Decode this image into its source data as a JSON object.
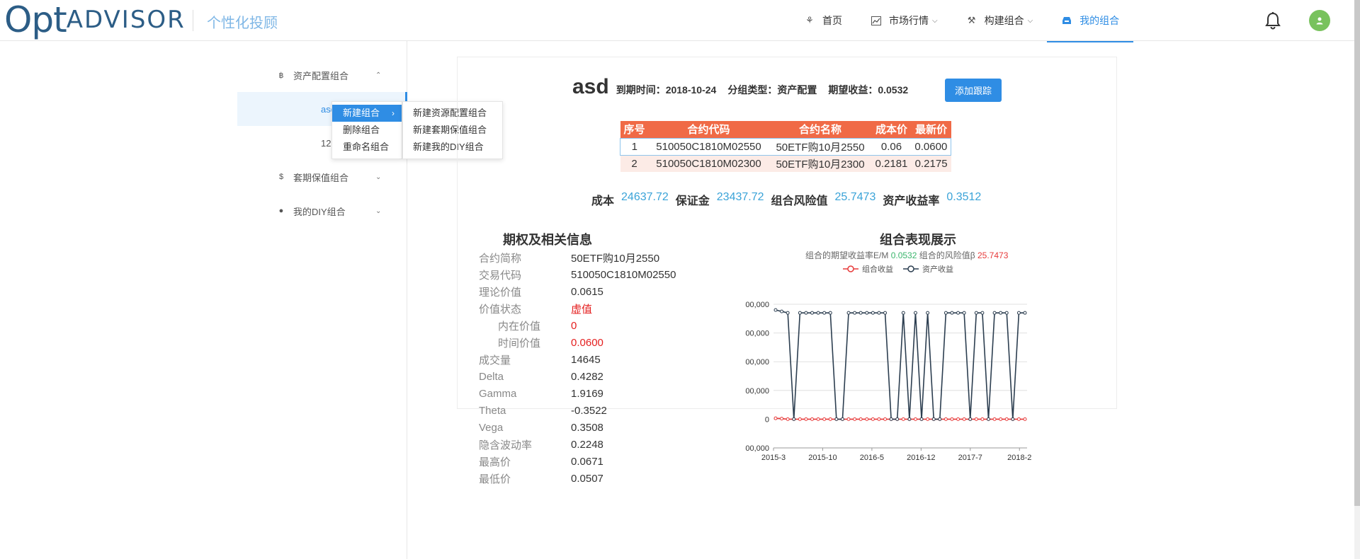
{
  "header": {
    "logo_opt": "Opt",
    "logo_advisor": "ADVISOR",
    "slogan": "个性化投顾",
    "nav": [
      {
        "label": "首页",
        "icon": "rocket-icon"
      },
      {
        "label": "市场行情",
        "icon": "chart-icon"
      },
      {
        "label": "构建组合",
        "icon": "tools-icon"
      },
      {
        "label": "我的组合",
        "icon": "inbox-icon"
      }
    ]
  },
  "sidebar": {
    "groups": [
      {
        "label": "资产配置组合",
        "icon": "bitcoin-icon",
        "caret": "^"
      },
      {
        "label": "套期保值组合",
        "icon": "dollar-icon",
        "caret": "v"
      },
      {
        "label": "我的DIY组合",
        "icon": "bulb-icon",
        "caret": "v"
      }
    ],
    "sub_items": [
      "asd",
      "12"
    ]
  },
  "context_menu": {
    "items": [
      "新建组合",
      "删除组合",
      "重命名组合"
    ],
    "submenu": [
      "新建资源配置组合",
      "新建套期保值组合",
      "新建我的DIY组合"
    ]
  },
  "portfolio": {
    "name": "asd",
    "expiry": "到期时间：2018-10-24",
    "group_type": "分组类型：资产配置",
    "expected": "期望收益：0.0532",
    "track_button": "添加跟踪"
  },
  "holdings": {
    "headers": [
      "序号",
      "合约代码",
      "合约名称",
      "成本价",
      "最新价"
    ],
    "rows": [
      [
        "1",
        "510050C1810M02550",
        "50ETF购10月2550",
        "0.06",
        "0.0600"
      ],
      [
        "2",
        "510050C1810M02300",
        "50ETF购10月2300",
        "0.2181",
        "0.2175"
      ]
    ]
  },
  "summary": [
    {
      "k": "成本",
      "v": "24637.72"
    },
    {
      "k": "保证金",
      "v": "23437.72"
    },
    {
      "k": "组合风险值",
      "v": "25.7473"
    },
    {
      "k": "资产收益率",
      "v": "0.3512"
    }
  ],
  "info": {
    "title": "期权及相关信息",
    "rows": [
      {
        "k": "合约简称",
        "v": "50ETF购10月2550"
      },
      {
        "k": "交易代码",
        "v": "510050C1810M02550"
      },
      {
        "k": "理论价值",
        "v": "0.0615"
      },
      {
        "k": "价值状态",
        "v": "虚值",
        "red": true
      },
      {
        "k": "内在价值",
        "v": "0",
        "red": true,
        "indent": true
      },
      {
        "k": "时间价值",
        "v": "0.0600",
        "red": true,
        "indent": true
      },
      {
        "k": "成交量",
        "v": "14645"
      },
      {
        "k": "Delta",
        "v": "0.4282"
      },
      {
        "k": "Gamma",
        "v": "1.9169"
      },
      {
        "k": "Theta",
        "v": "-0.3522"
      },
      {
        "k": "Vega",
        "v": "0.3508"
      },
      {
        "k": "隐含波动率",
        "v": "0.2248"
      },
      {
        "k": "最高价",
        "v": "0.0671"
      },
      {
        "k": "最低价",
        "v": "0.0507"
      }
    ]
  },
  "chart_panel": {
    "title": "组合表现展示",
    "sub_prefix": "组合的期望收益率E/M",
    "sub_em": "0.0532",
    "sub_mid": "组合的风险值β",
    "sub_beta": "25.7473"
  },
  "chart_data": {
    "type": "line",
    "yticks": [
      "00,000",
      "00,000",
      "00,000",
      "00,000",
      "0",
      "00,000"
    ],
    "xticks": [
      "2015-3",
      "2015-10",
      "2016-5",
      "2016-12",
      "2017-7",
      "2018-2"
    ],
    "ylim": [
      -1,
      4
    ],
    "series": [
      {
        "name": "组合收益",
        "color": "#e73a3a",
        "values": [
          0.03,
          0.02,
          0,
          0,
          0,
          0,
          0,
          0,
          0,
          0,
          0,
          0,
          0,
          0,
          0,
          0,
          0,
          0,
          0,
          0,
          0,
          0,
          0,
          0,
          0,
          0,
          0,
          0,
          0,
          0,
          0,
          0,
          0,
          0,
          0,
          0,
          0,
          0,
          0,
          0,
          0,
          0
        ]
      },
      {
        "name": "资产收益",
        "color": "#2c3e50",
        "values": [
          3.8,
          3.75,
          3.7,
          0,
          3.7,
          3.7,
          3.7,
          3.7,
          3.7,
          3.7,
          0,
          0,
          3.7,
          3.7,
          3.7,
          3.7,
          3.7,
          3.7,
          3.7,
          0,
          0,
          3.7,
          0,
          3.7,
          0,
          3.7,
          0,
          0,
          3.7,
          3.7,
          3.7,
          3.7,
          0,
          3.7,
          3.7,
          0,
          3.7,
          3.7,
          3.7,
          0,
          3.7,
          3.7
        ]
      }
    ]
  }
}
